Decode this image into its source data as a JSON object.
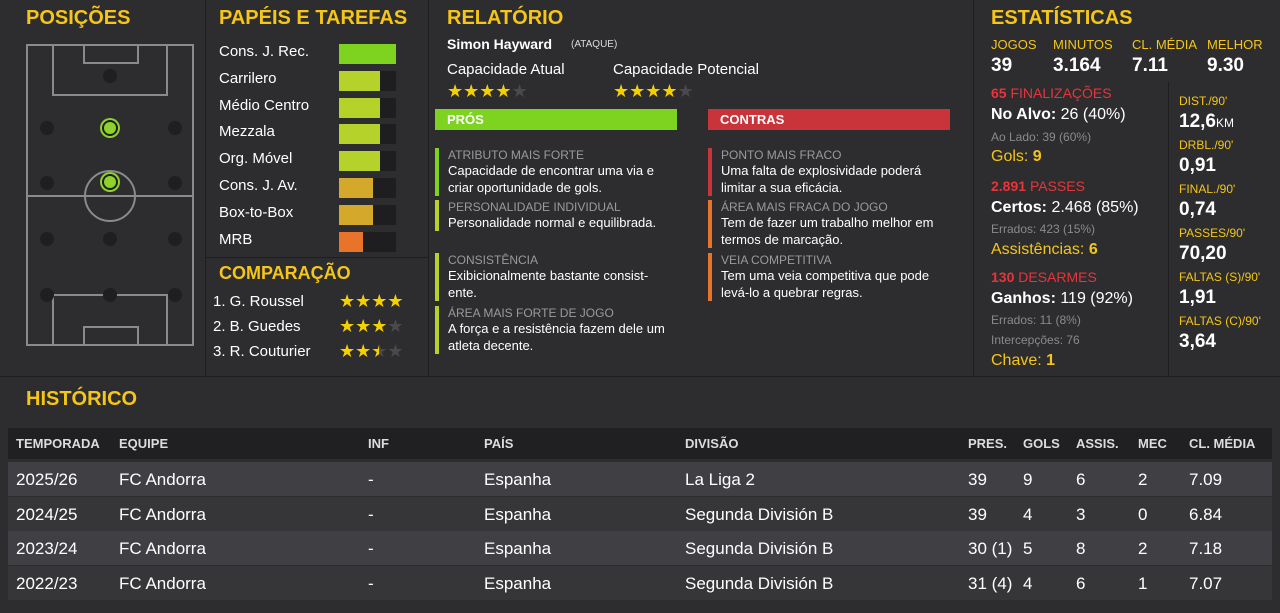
{
  "sections": {
    "positions": "POSIÇÕES",
    "roles": "PAPÉIS E TAREFAS",
    "report": "RELATÓRIO",
    "stats": "ESTATÍSTICAS",
    "comparison": "COMPARAÇÃO",
    "history": "HISTÓRICO"
  },
  "roles": [
    {
      "label": "Cons. J. Rec.",
      "level": 1.0,
      "color": "#7ed321"
    },
    {
      "label": "Carrilero",
      "level": 0.72,
      "color": "#b4d22a"
    },
    {
      "label": "Médio Centro",
      "level": 0.72,
      "color": "#b4d22a"
    },
    {
      "label": "Mezzala",
      "level": 0.72,
      "color": "#b4d22a"
    },
    {
      "label": "Org. Móvel",
      "level": 0.72,
      "color": "#b4d22a"
    },
    {
      "label": "Cons. J. Av.",
      "level": 0.6,
      "color": "#d4a82a"
    },
    {
      "label": "Box-to-Box",
      "level": 0.6,
      "color": "#d4a82a"
    },
    {
      "label": "MRB",
      "level": 0.42,
      "color": "#e8732a"
    }
  ],
  "comparison": [
    {
      "label": "1. G. Roussel",
      "stars": 4
    },
    {
      "label": "2. B. Guedes",
      "stars": 3
    },
    {
      "label": "3. R. Couturier",
      "stars": 2.5
    }
  ],
  "report": {
    "name": "Simon Hayward",
    "position": "(ATAQUE)",
    "current_label": "Capacidade Atual",
    "current_stars": 4,
    "potential_label": "Capacidade Potencial",
    "potential_stars": 4,
    "pros_label": "PRÓS",
    "cons_label": "CONTRAS",
    "pros": [
      {
        "title": "ATRIBUTO MAIS FORTE",
        "text": "Capacidade de encontrar uma via e criar oportunidade de gols.",
        "color": "#7ed321"
      },
      {
        "title": "PERSONALIDADE INDIVIDUAL",
        "text": "Personalidade normal e equilibrada.",
        "color": "#b4d22a"
      },
      {
        "title": "CONSISTÊNCIA",
        "text": "Exibicionalmente bastante consist-ente.",
        "color": "#b4d22a"
      },
      {
        "title": "ÁREA MAIS FORTE DE JOGO",
        "text": "A força e a resistência fazem dele um atleta decente.",
        "color": "#b4d22a"
      }
    ],
    "cons": [
      {
        "title": "PONTO MAIS FRACO",
        "text": "Uma falta de explosividade poderá limitar a sua eficácia.",
        "color": "#c8343a"
      },
      {
        "title": "ÁREA MAIS FRACA DO JOGO",
        "text": "Tem de fazer um trabalho melhor em termos de marcação.",
        "color": "#e8732a"
      },
      {
        "title": "VEIA COMPETITIVA",
        "text": "Tem uma veia competitiva que pode levá-lo a quebrar regras.",
        "color": "#e8732a"
      }
    ]
  },
  "stats": {
    "top": [
      {
        "label": "JOGOS",
        "value": "39"
      },
      {
        "label": "MINUTOS",
        "value": "3.164"
      },
      {
        "label": "CL. MÉDIA",
        "value": "7.11"
      },
      {
        "label": "MELHOR",
        "value": "9.30"
      }
    ],
    "shots": {
      "head_num": "65",
      "head_label": "FINALIZAÇÕES",
      "on_label": "No Alvo:",
      "on_value": "26 (40%)",
      "off": "Ao Lado: 39 (60%)",
      "goals_label": "Gols:",
      "goals_value": "9"
    },
    "passes": {
      "head_num": "2.891",
      "head_label": "PASSES",
      "ok_label": "Certos:",
      "ok_value": "2.468 (85%)",
      "miss": "Errados: 423 (15%)",
      "assists_label": "Assistências:",
      "assists_value": "6"
    },
    "tackles": {
      "head_num": "130",
      "head_label": "DESARMES",
      "won_label": "Ganhos:",
      "won_value": "119 (92%)",
      "miss": "Errados: 11 (8%)",
      "int": "Intercepções: 76",
      "key_label": "Chave:",
      "key_value": "1"
    },
    "per90": [
      {
        "label": "DIST./90'",
        "value": "12,6",
        "unit": "KM"
      },
      {
        "label": "DRBL./90'",
        "value": "0,91",
        "unit": ""
      },
      {
        "label": "FINAL./90'",
        "value": "0,74",
        "unit": ""
      },
      {
        "label": "PASSES/90'",
        "value": "70,20",
        "unit": ""
      },
      {
        "label": "FALTAS (S)/90'",
        "value": "1,91",
        "unit": ""
      },
      {
        "label": "FALTAS (C)/90'",
        "value": "3,64",
        "unit": ""
      }
    ]
  },
  "history": {
    "headers": [
      "TEMPORADA",
      "EQUIPE",
      "INF",
      "PAÍS",
      "DIVISÃO",
      "PRES.",
      "GOLS",
      "ASSIS.",
      "MEC",
      "CL. MÉDIA"
    ],
    "rows": [
      [
        "2025/26",
        "FC Andorra",
        "-",
        "Espanha",
        "La Liga 2",
        "39",
        "9",
        "6",
        "2",
        "7.09"
      ],
      [
        "2024/25",
        "FC Andorra",
        "-",
        "Espanha",
        "Segunda División B",
        "39",
        "4",
        "3",
        "0",
        "6.84"
      ],
      [
        "2023/24",
        "FC Andorra",
        "-",
        "Espanha",
        "Segunda División B",
        "30 (1)",
        "5",
        "8",
        "2",
        "7.18"
      ],
      [
        "2022/23",
        "FC Andorra",
        "-",
        "Espanha",
        "Segunda División B",
        "31 (4)",
        "4",
        "6",
        "1",
        "7.07"
      ]
    ]
  },
  "colors": {
    "accent": "#f5c518",
    "pros": "#7ed321",
    "cons": "#c8343a",
    "red_head": "#e8343a"
  }
}
